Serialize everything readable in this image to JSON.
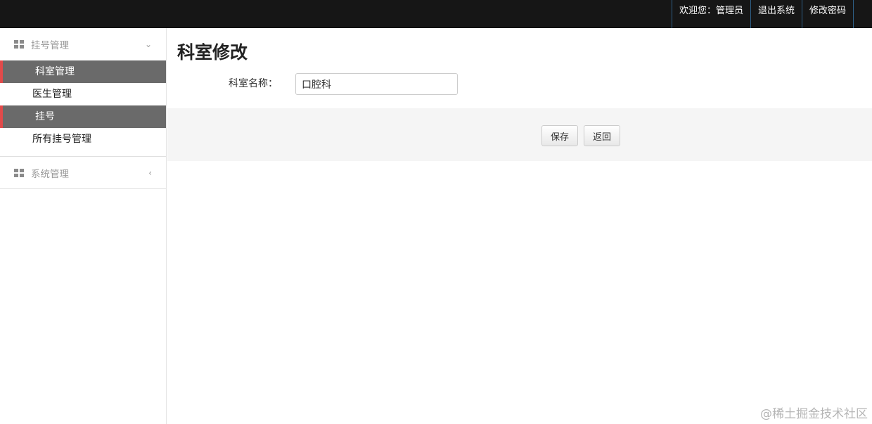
{
  "topbar": {
    "welcome": "欢迎您：管理员",
    "logout": "退出系统",
    "change_password": "修改密码"
  },
  "sidebar": {
    "groups": [
      {
        "label": "挂号管理",
        "icon": "grid-icon",
        "expanded": true,
        "chevron": "⌄",
        "items": [
          {
            "label": "科室管理",
            "active": true
          },
          {
            "label": "医生管理",
            "active": false
          },
          {
            "label": "挂号",
            "active": true
          },
          {
            "label": "所有挂号管理",
            "active": false
          }
        ]
      },
      {
        "label": "系统管理",
        "icon": "grid-icon",
        "expanded": false,
        "chevron": "‹"
      }
    ]
  },
  "main": {
    "title": "科室修改",
    "form": {
      "dept_label": "科室名称：",
      "dept_value": "口腔科"
    },
    "buttons": {
      "save": "保存",
      "back": "返回"
    }
  },
  "watermark": "@稀土掘金技术社区",
  "colors": {
    "topbar_bg": "#161616",
    "active_item_bg": "#6a6a6a",
    "active_item_marker": "#e24a4a",
    "actions_bg": "#f5f5f5"
  }
}
